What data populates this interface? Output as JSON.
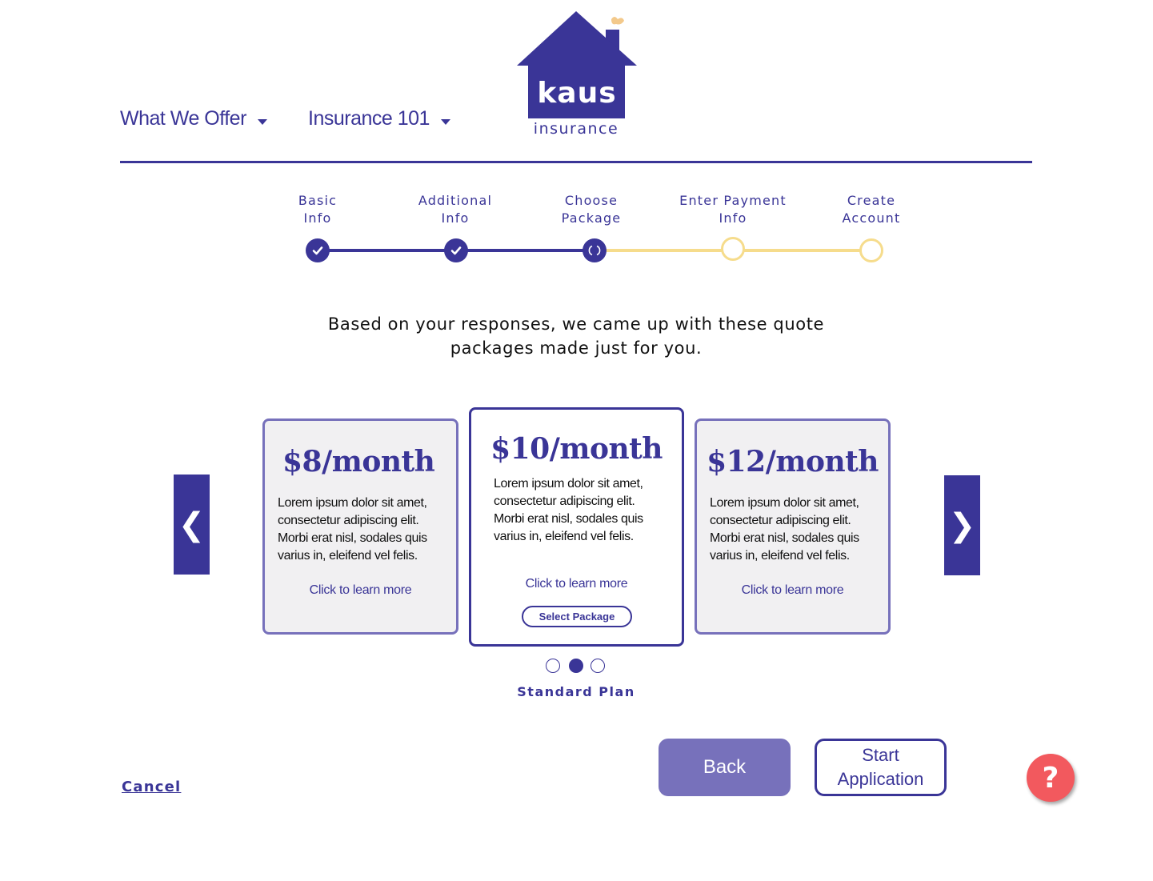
{
  "nav": {
    "items": [
      {
        "label": "What We Offer"
      },
      {
        "label": "Insurance 101"
      }
    ]
  },
  "logo": {
    "name": "kaus",
    "sub": "insurance"
  },
  "stepper": {
    "steps": [
      {
        "line1": "Basic",
        "line2": "Info",
        "state": "done"
      },
      {
        "line1": "Additional",
        "line2": "Info",
        "state": "done"
      },
      {
        "line1": "Choose",
        "line2": "Package",
        "state": "current"
      },
      {
        "line1": "Enter Payment",
        "line2": "Info",
        "state": "todo"
      },
      {
        "line1": "Create",
        "line2": "Account",
        "state": "todo"
      }
    ]
  },
  "intro": {
    "line1": "Based on your responses, we came up with these quote",
    "line2": "packages made just for you."
  },
  "cards": [
    {
      "price": "$8/month",
      "desc": "Lorem ipsum dolor sit amet, consectetur adipiscing elit. Morbi erat nisl, sodales quis varius in, eleifend vel felis.",
      "learn": "Click to learn more"
    },
    {
      "price": "$10/month",
      "desc": "Lorem ipsum dolor sit amet, consectetur adipiscing elit. Morbi erat nisl, sodales quis varius in, eleifend vel felis.",
      "learn": "Click to learn more",
      "select": "Select Package"
    },
    {
      "price": "$12/month",
      "desc": "Lorem ipsum dolor sit amet, consectetur adipiscing elit. Morbi erat nisl, sodales quis varius in, eleifend vel felis.",
      "learn": "Click to learn more"
    }
  ],
  "carousel": {
    "prev_icon": "chevron-left-icon",
    "next_icon": "chevron-right-icon",
    "prev_glyph": "❮",
    "next_glyph": "❯",
    "active_index": 2,
    "plan_name": "Standard Plan"
  },
  "actions": {
    "cancel": "Cancel",
    "back": "Back",
    "start_line1": "Start",
    "start_line2": "Application",
    "help": "?"
  },
  "colors": {
    "primary": "#3a3597",
    "secondary": "#7771bb",
    "pending": "#f6dc8c",
    "help": "#f2595e",
    "card_bg": "#f1f0f2",
    "smoke": "#f3c98b"
  }
}
